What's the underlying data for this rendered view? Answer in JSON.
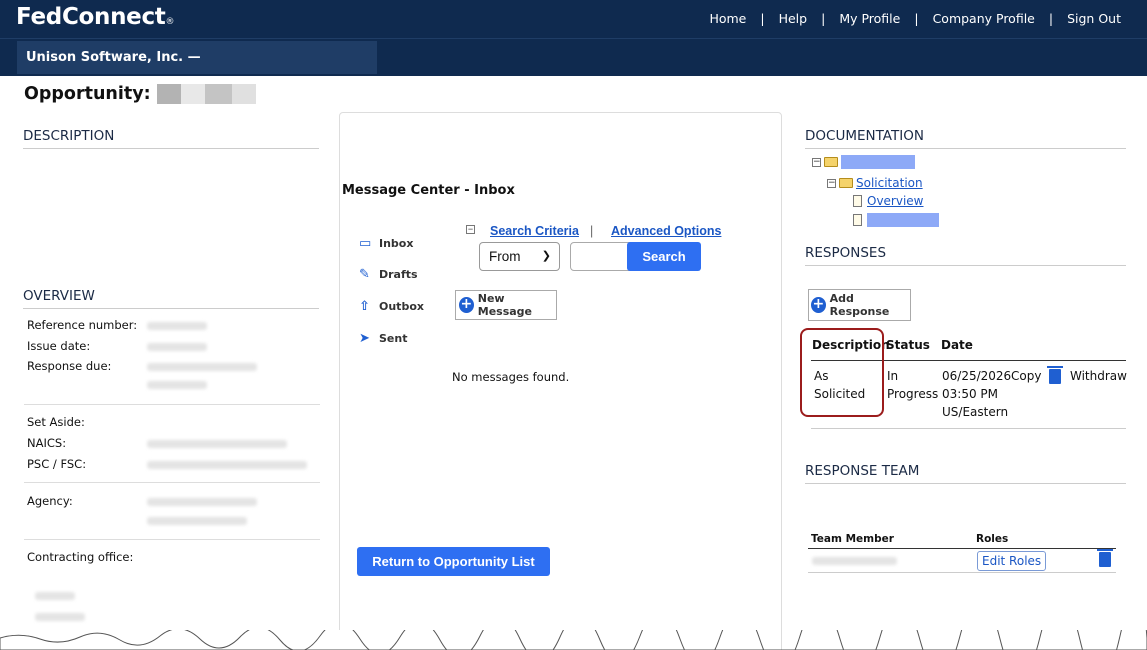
{
  "brand": {
    "name": "FedConnect",
    "mark": "®"
  },
  "topnav": [
    "Home",
    "Help",
    "My Profile",
    "Company Profile",
    "Sign Out"
  ],
  "company": "Unison Software, Inc. —",
  "opportunity_label": "Opportunity:",
  "left": {
    "description_header": "DESCRIPTION",
    "overview_header": "OVERVIEW",
    "fields": {
      "reference": "Reference number:",
      "issue": "Issue date:",
      "response_due": "Response due:",
      "set_aside": "Set Aside:",
      "naics": "NAICS:",
      "psc": "PSC / FSC:",
      "agency": "Agency:",
      "contracting": "Contracting office:"
    }
  },
  "message_center": {
    "title": "Message Center - Inbox",
    "nav": [
      "Inbox",
      "Drafts",
      "Outbox",
      "Sent"
    ],
    "search_criteria": "Search Criteria",
    "advanced_options": "Advanced Options",
    "select_value": "From",
    "search_button": "Search",
    "new_message": "New Message",
    "empty": "No messages found.",
    "return_button": "Return to Opportunity List"
  },
  "right": {
    "documentation_header": "DOCUMENTATION",
    "tree": {
      "solicitation": "Solicitation",
      "overview": "Overview"
    },
    "responses_header": "RESPONSES",
    "add_response": "Add Response",
    "columns": [
      "Description",
      "Status",
      "Date"
    ],
    "row": {
      "description_1": "As",
      "description_2": "Solicited",
      "status_1": "In",
      "status_2": "Progress",
      "date_1": "06/25/2026",
      "date_2": "03:50 PM",
      "date_3": "US/Eastern",
      "copy": "Copy",
      "withdraw": "Withdraw"
    },
    "team_header": "RESPONSE TEAM",
    "team_columns": [
      "Team Member",
      "Roles"
    ],
    "edit_roles": "Edit Roles"
  },
  "colors": {
    "navy": "#0f2a4f",
    "accent": "#2e6ff2",
    "link": "#1a56c4",
    "highlight": "#9b1c1c"
  }
}
